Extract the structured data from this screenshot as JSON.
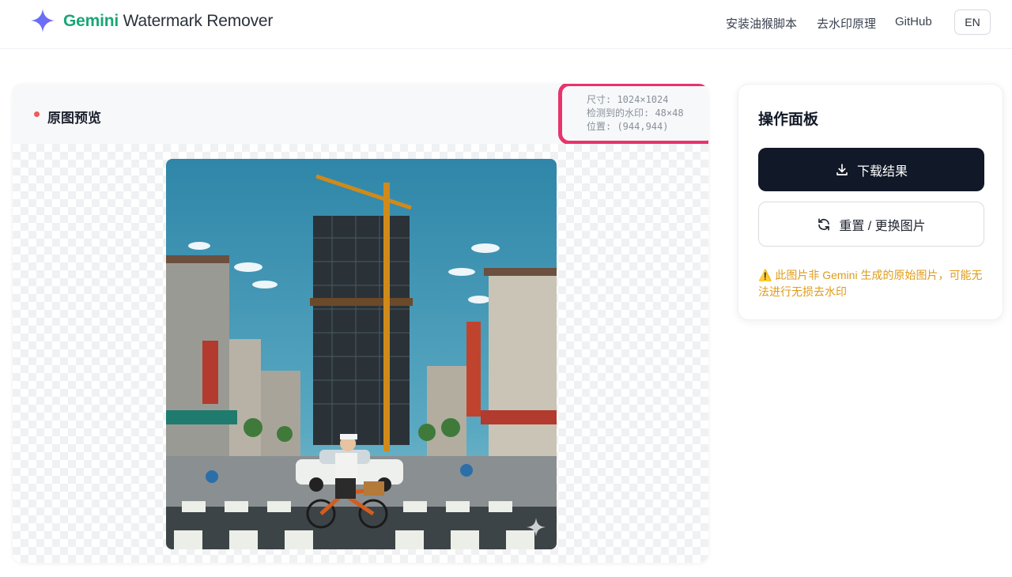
{
  "header": {
    "brand_accent": "Gemini",
    "brand_rest": " Watermark Remover",
    "nav": [
      "安装油猴脚本",
      "去水印原理",
      "GitHub"
    ],
    "lang": "EN"
  },
  "preview": {
    "title": "原图预览",
    "meta": {
      "size": "尺寸: 1024×1024",
      "watermark": "检测到的水印: 48×48",
      "position": "位置: (944,944)"
    }
  },
  "panel": {
    "title": "操作面板",
    "download_label": "下载结果",
    "reset_label": "重置 / 更换图片",
    "warning": "⚠️ 此图片非 Gemini 生成的原始图片，可能无法进行无损去水印"
  },
  "colors": {
    "accent_green": "#1aa776",
    "highlight": "#e8336b",
    "warning": "#e09b18",
    "dark_button": "#111827"
  },
  "icons": [
    "gemini-star-icon",
    "download-icon",
    "refresh-icon",
    "sparkle-watermark-icon"
  ]
}
